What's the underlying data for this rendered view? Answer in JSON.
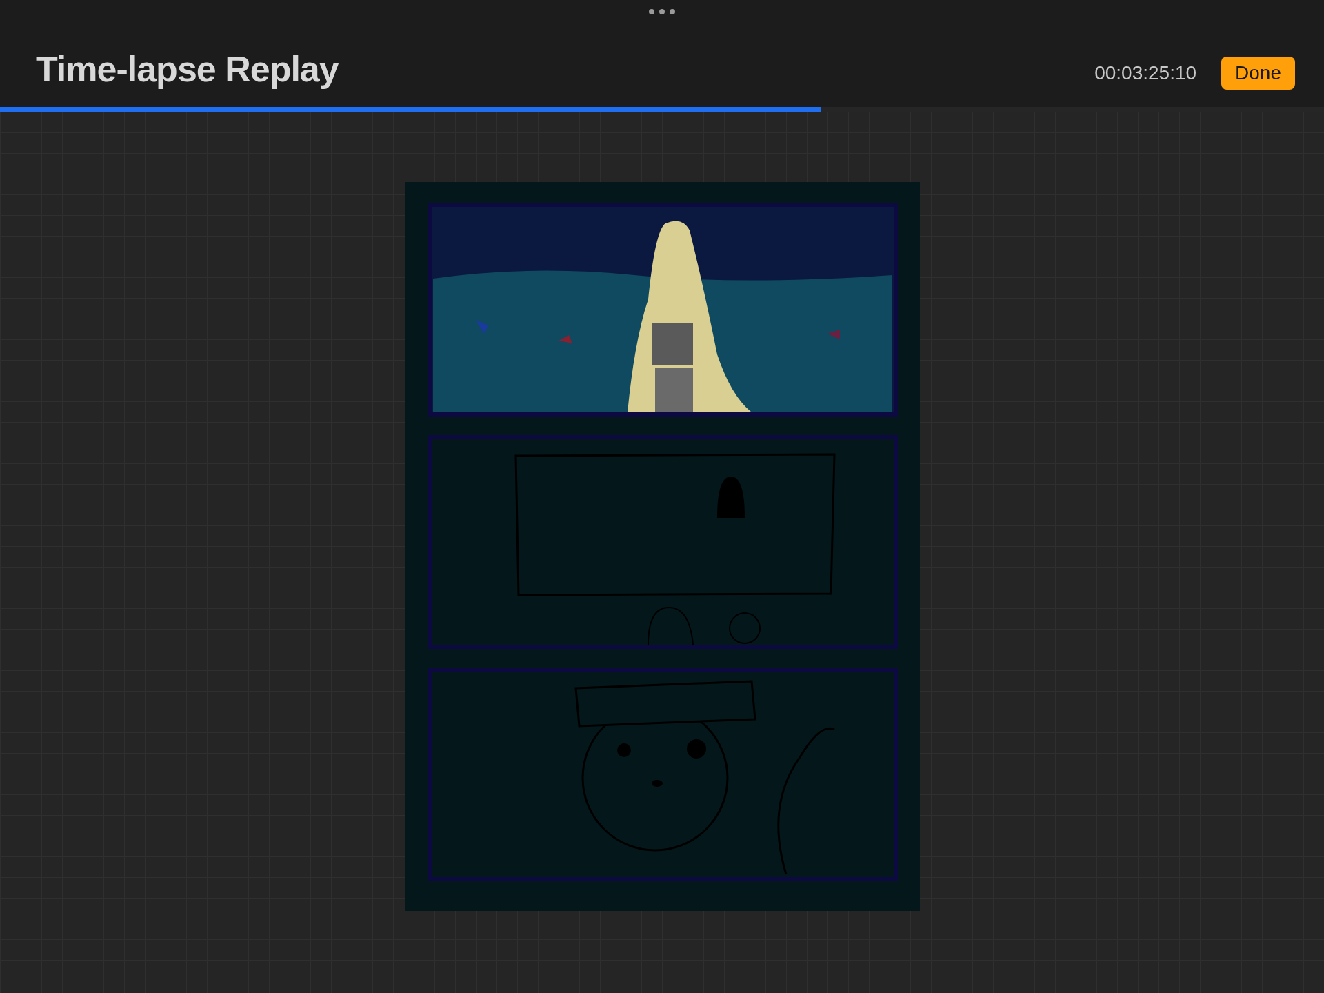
{
  "header": {
    "title": "Time-lapse Replay",
    "time": "00:03:25:10",
    "done_button": "Done"
  },
  "progress": {
    "level": 0.62
  }
}
